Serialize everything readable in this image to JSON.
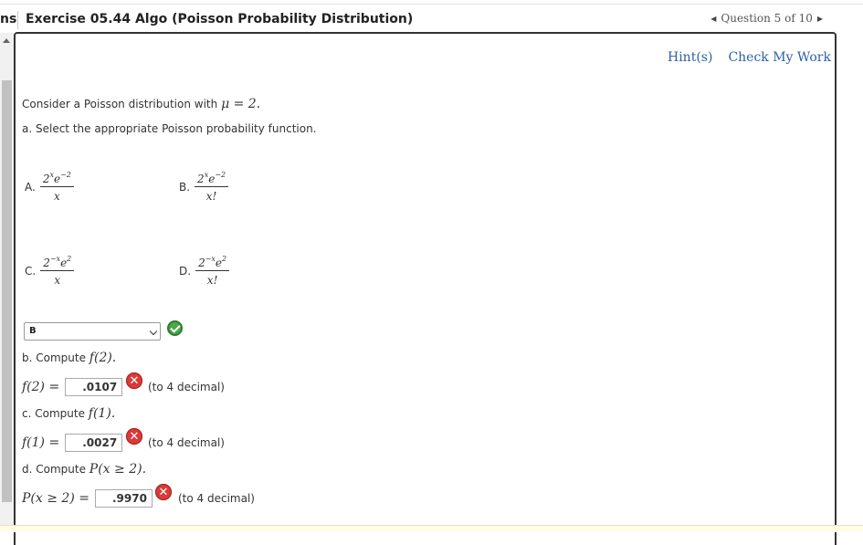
{
  "header": {
    "prefix": "ns",
    "title": "Exercise 05.44 Algo (Poisson Probability Distribution)",
    "question_counter": "Question 5 of 10"
  },
  "toolbar": {
    "hint": "Hint(s)",
    "check": "Check My Work"
  },
  "problem": {
    "intro_text": "Consider a Poisson distribution with",
    "intro_math": "μ = 2.",
    "part_a": "a. Select the appropriate Poisson probability function."
  },
  "options": [
    {
      "label": "A.",
      "num_base": "2",
      "num_exp": "x",
      "num_e": "e",
      "num_e_exp": "−2",
      "den": "x"
    },
    {
      "label": "B.",
      "num_base": "2",
      "num_exp": "x",
      "num_e": "e",
      "num_e_exp": "−2",
      "den": "x!"
    },
    {
      "label": "C.",
      "num_base": "2",
      "num_exp": "−x",
      "num_e": "e",
      "num_e_exp": "2",
      "den": "x"
    },
    {
      "label": "D.",
      "num_base": "2",
      "num_exp": "−x",
      "num_e": "e",
      "num_e_exp": "2",
      "den": "x!"
    }
  ],
  "select": {
    "value": "B",
    "status": "correct"
  },
  "part_b": {
    "prompt": "b. Compute",
    "prompt_math": "f(2).",
    "lhs": "f(2) =",
    "answer": ".0107",
    "suffix": "(to 4 decimal)",
    "status": "incorrect"
  },
  "part_c": {
    "prompt": "c. Compute",
    "prompt_math": "f(1).",
    "lhs": "f(1) =",
    "answer": ".0027",
    "suffix": "(to 4 decimal)",
    "status": "incorrect"
  },
  "part_d": {
    "prompt": "d. Compute",
    "prompt_math": "P(x ≥ 2).",
    "lhs": "P(x ≥ 2) =",
    "answer": ".9970",
    "suffix": "(to 4 decimal)",
    "status": "incorrect"
  },
  "icons": {
    "correct": "check-circle-icon",
    "incorrect": "x-circle-icon"
  },
  "colors": {
    "link": "#2a5fa8",
    "correct": "#4ca84a",
    "incorrect": "#d93a3a"
  }
}
